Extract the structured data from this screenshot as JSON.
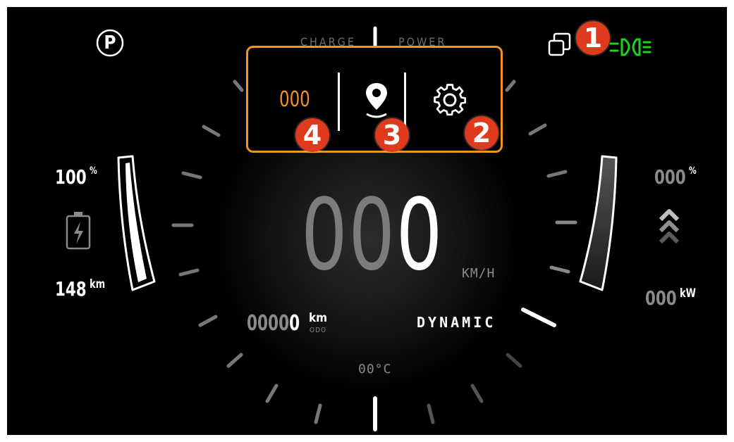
{
  "header": {
    "gear": "P",
    "charge_label": "CHARGE",
    "power_label": "POWER"
  },
  "menu": {
    "trip_value": "000",
    "items": [
      {
        "name": "trip",
        "icon": "counter-icon"
      },
      {
        "name": "navigation",
        "icon": "map-pin-icon"
      },
      {
        "name": "settings",
        "icon": "gear-icon"
      }
    ]
  },
  "badges": {
    "b1": "1",
    "b2": "2",
    "b3": "3",
    "b4": "4"
  },
  "left": {
    "battery_percent": "100",
    "percent_unit": "%",
    "range_value": "148",
    "range_unit": "km",
    "battery_level": 1.0
  },
  "right": {
    "power_percent": "000",
    "percent_unit": "%",
    "power_value": "000",
    "power_unit": "kW"
  },
  "center": {
    "speed_dim": "00",
    "speed_bright": "0",
    "speed_unit": "KM/H",
    "odo_dim": "0000",
    "odo_bright": "0",
    "odo_unit": "km",
    "odo_label": "ODO",
    "drive_mode": "DYNAMIC",
    "temperature": "00°C"
  },
  "colors": {
    "accent": "#f39322",
    "badge": "#e03a1c",
    "headlight": "#1fd11f",
    "background": "#000000"
  }
}
